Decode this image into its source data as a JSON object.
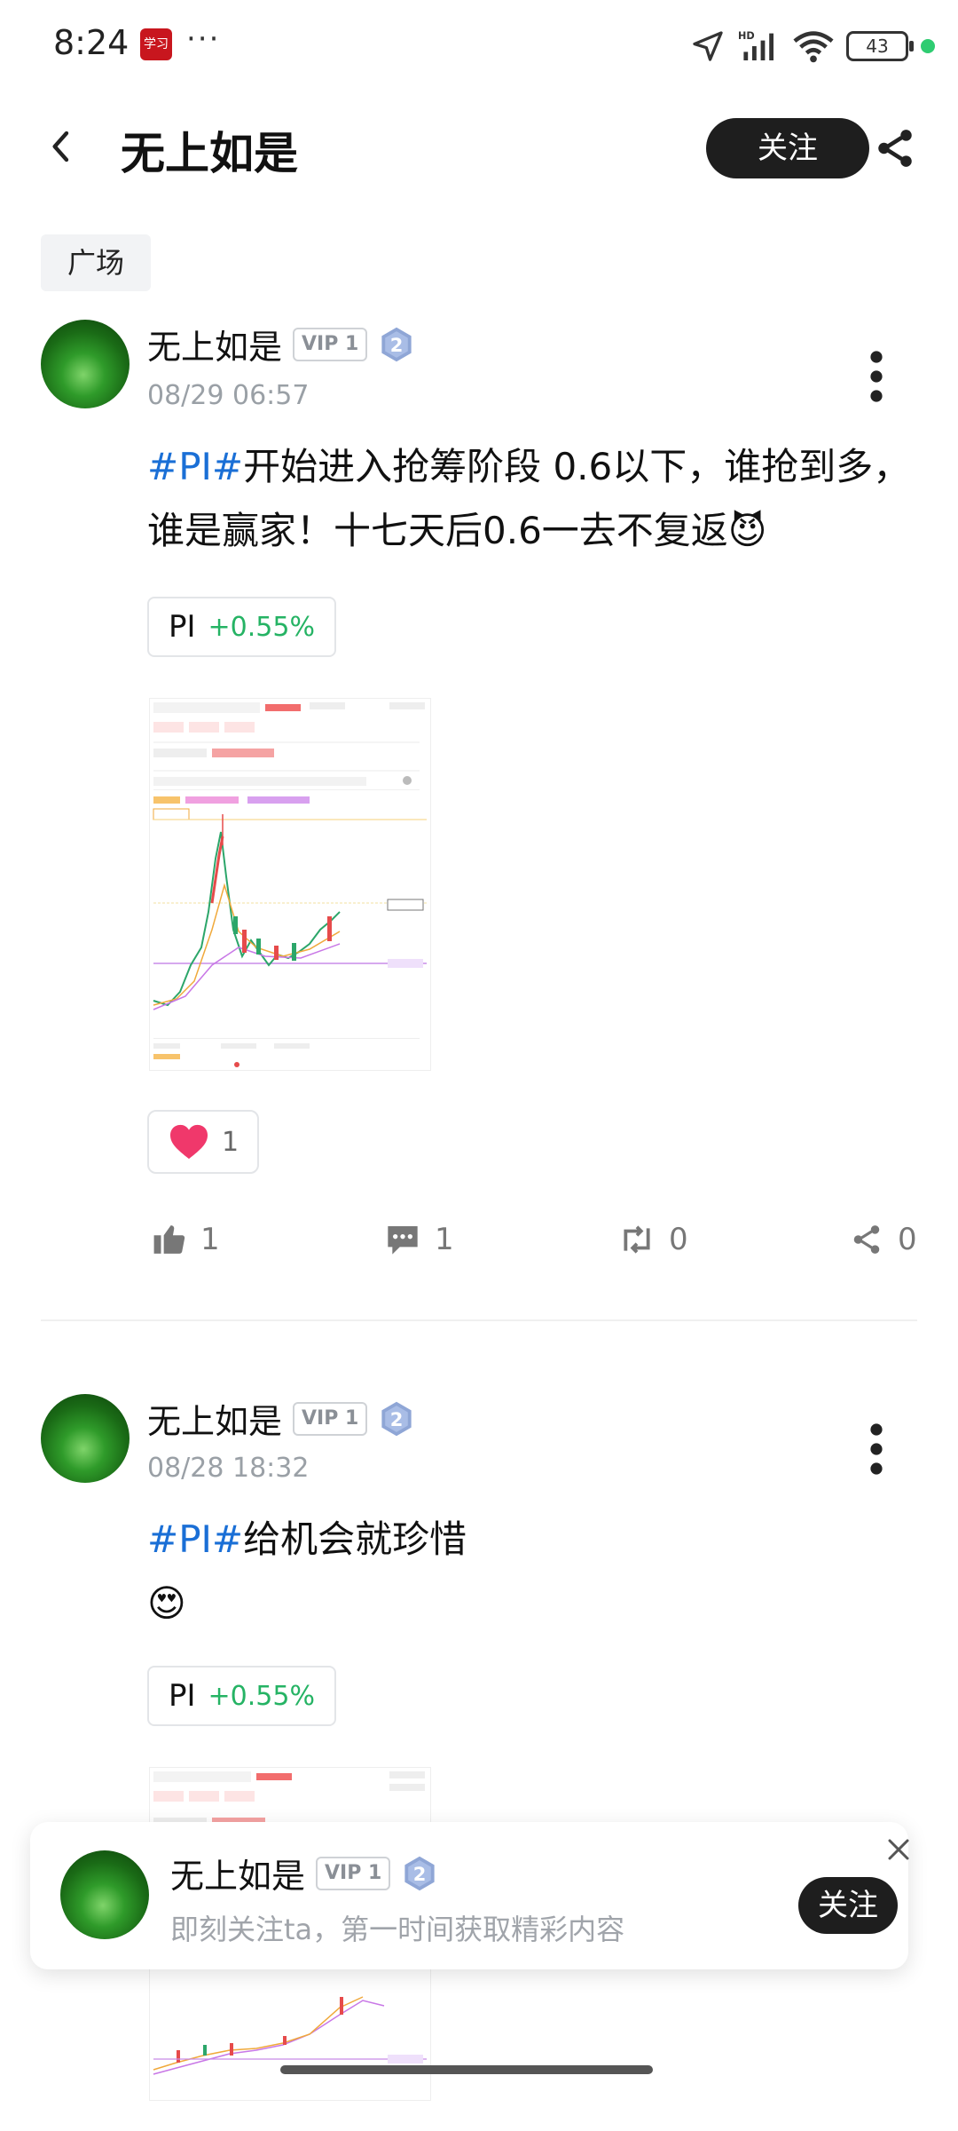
{
  "status": {
    "time": "8:24",
    "app_badge": "学习",
    "dots": "···",
    "battery": "43"
  },
  "header": {
    "title": "无上如是",
    "follow_label": "关注"
  },
  "tag": "广场",
  "posts": [
    {
      "author": "无上如是",
      "vip": "VIP 1",
      "level": "2",
      "time": "08/29 06:57",
      "hashtag": "#PI#",
      "text": "开始进入抢筹阶段 0.6以下，谁抢到多，谁是赢家！十七天后0.6一去不复返",
      "emoji": "😈",
      "coin": {
        "symbol": "PI",
        "change": "+0.55%"
      },
      "reaction_count": "1",
      "actions": {
        "like": "1",
        "comment": "1",
        "repost": "0",
        "share": "0"
      }
    },
    {
      "author": "无上如是",
      "vip": "VIP 1",
      "level": "2",
      "time": "08/28 18:32",
      "hashtag": "#PI#",
      "text": "给机会就珍惜",
      "emoji": "😍",
      "coin": {
        "symbol": "PI",
        "change": "+0.55%"
      }
    }
  ],
  "follow_card": {
    "author": "无上如是",
    "vip": "VIP 1",
    "level": "2",
    "subtitle": "即刻关注ta，第一时间获取精彩内容",
    "follow_label": "关注"
  },
  "colors": {
    "accent_blue": "#1a6fd6",
    "up_green": "#25b364",
    "dark_button": "#1e1e1e"
  }
}
